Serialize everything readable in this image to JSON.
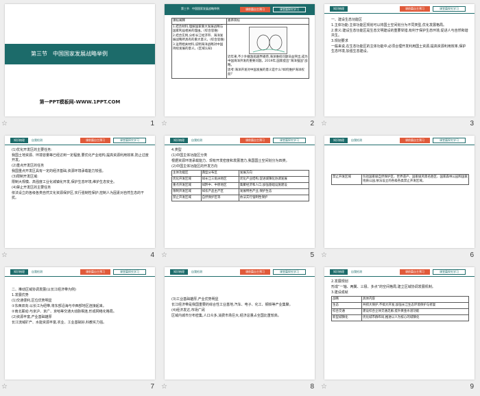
{
  "pages": [
    {
      "number": "1",
      "title": "第三节　中国国家发展战略举例",
      "footer": "第一PPT模板网-WWW.1PPT.COM"
    },
    {
      "number": "2",
      "header": "第三节　中国国家发展战略举例",
      "badge1": "课前篇自主预习",
      "badge2": "课堂篇探究学习",
      "col1": "课标阐释",
      "col2": "素养目标",
      "left_lines": [
        "1.结合材料,理解国家重大发展战略与国家利益相关的理由。(综合思维)",
        "2.结合实例,分析长江经济带、海洋发展战略所具有的重大意义。(综合思维)",
        "3.运用相关材料,说明海洋战略对中国持续发展的意义。(区域认知)"
      ],
      "right_lines": [
        "近年来,不少外籍渔船越界捕捞,海洋维权问题日益突出,成为中国海洋开发的重要问题。2019年,国家提出“海洋强国”战略。",
        "思考:海洋开发对中国发展的意义是什么?如何维护海洋权益?"
      ]
    },
    {
      "number": "3",
      "tab1": "知识梳理",
      "tab2": "",
      "badge1": "课前篇自主预习",
      "badge2": "课堂篇探究学习",
      "lines": [
        "一、建设生态功能区",
        "1.主体功能:主体功能区规划可以将国土空间划分为不同类型,优化发展格局。",
        "2.意义:建设生态功能区是生态文明建设的重要举措,有利于保护生态环境,促进人与自然和谐共生。",
        "3.规划要求",
        "一般来说,在生态功能区的主体功能中,必须合理开发利用国土资源,提高资源利用效率,保护生态环境,加强生态建设。"
      ]
    },
    {
      "number": "4",
      "tab1": "知识梳理",
      "tab2": "自我检测",
      "badge1": "课前篇自主预习",
      "badge2": "课堂篇探究学习",
      "lines": [
        "(1)优化开发区的主要任务:",
        "我国土地资源、环境容量等已经达到一定程度,要优化产业结构,提高资源利用效率,防止过度开发。",
        "(2)重点开发区的任务",
        "我国重点开发区具有一定的经济基础,资源环境承载能力较强。",
        "(3)限制开发区域:",
        "限制大规模、高强度工业化城镇化开发,保护生态环境,维护生态安全。",
        "(4)禁止开发区的主要任务",
        "依法设立的各级各类自然文化资源保护区,实行强制性保护,控制人为因素对自然生态的干扰。"
      ]
    },
    {
      "number": "5",
      "tab1": "知识梳理",
      "tab2": "自我检测",
      "badge1": "课前篇自主预习",
      "badge2": "课堂篇探究学习",
      "intro": [
        "4.类型",
        "(1)中国主体功能区分类",
        "根据资源环境承载能力、现有开发密度和发展潜力,我国国土空间划分为四类。",
        "(2)中国主体功能区的开发方向"
      ],
      "thead": [
        "主体功能区",
        "典型分布区",
        "发展方向"
      ],
      "rows": [
        [
          "优化开发区域",
          "如长江三角洲地区",
          "优化产业结构,促进城镇化协调发展"
        ],
        [
          "重点开发区域",
          "如黔中、中原地区",
          "集聚经济和人口,加强基础设施建设"
        ],
        [
          "限制开发区域",
          "如农产品主产区",
          "发展特色产业,保护生态"
        ],
        [
          "禁止开发区域",
          "自然保护区等",
          "依法实行强制性保护"
        ]
      ]
    },
    {
      "number": "6",
      "tab1": "知识梳理",
      "tab2": "自我检测",
      "badge1": "课前篇自主预习",
      "badge2": "课堂篇探究学习",
      "row_label": "禁止开发区域",
      "row_text": "包括国家级自然保护区、世界遗产、国家级风景名胜区、国家森林公园和国家地质公园,依法设立的各级各类禁止开发区域。"
    },
    {
      "number": "7",
      "tab1": "知识梳理",
      "tab2": "自我检测",
      "badge1": "课前篇自主预习",
      "badge2": "课堂篇探究学习",
      "lines": [
        "二、推动区域协调发展(以长江经济带为例)",
        "1.发展优势",
        "(1)交通便利,区位优势明显",
        "①东西双向:以长江为纽带,将东部沿海与中西部地区连接起来。",
        "②南北联动:与京沪、京广、京哈等交通大动脉相连,形成网络化格局。",
        "(2)资源丰富,产业基础雄厚",
        "长江流域矿产、水能资源丰富,农业、工业基础好,科教实力强。"
      ]
    },
    {
      "number": "8",
      "tab1": "知识梳理",
      "tab2": "自我检测",
      "badge1": "课前篇自主预习",
      "badge2": "课堂篇探究学习",
      "lines": [
        "(3)工业基础雄厚,产业优势明显",
        "长江经济带是我国重要的综合性工业基地,汽车、电子、化工、钢铁等产业集聚。",
        "(4)经济发达,市场广阔",
        "区域内城市分布密集,人口众多,消费市场巨大,经济总量占全国比重较高。"
      ]
    },
    {
      "number": "9",
      "tab1": "知识梳理",
      "tab2": "自我检测",
      "badge1": "课前篇自主预习",
      "badge2": "课堂篇探究学习",
      "lines": [
        "2.发展规划",
        "形成“一轴、两翼、三极、多点”的空间格局,建立区域协调发展机制。",
        "3.建设成就"
      ],
      "thead": [
        "战略",
        "具体内容"
      ],
      "rows": [
        [
          "生态",
          "共抓大保护,不搞大开发,加强长江生态环境保护与修复"
        ],
        [
          "综合交通",
          "建设综合立体交通走廊,提升黄金水道功能"
        ],
        [
          "新型城镇化",
          "优化城市群布局,推进以人为核心的城镇化"
        ]
      ]
    }
  ]
}
